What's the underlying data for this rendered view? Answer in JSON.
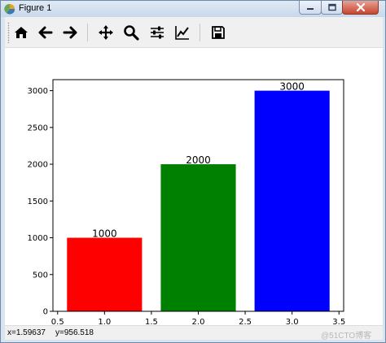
{
  "window": {
    "title": "Figure 1"
  },
  "toolbar": {
    "buttons": [
      {
        "icon": "home-icon"
      },
      {
        "icon": "back-arrow-icon"
      },
      {
        "icon": "forward-arrow-icon"
      },
      {
        "icon": "pan-icon"
      },
      {
        "icon": "zoom-icon"
      },
      {
        "icon": "subplots-icon"
      },
      {
        "icon": "edit-axis-icon"
      },
      {
        "icon": "save-icon"
      }
    ]
  },
  "status": {
    "x_readout": "x=1.59637",
    "y_readout": "y=956.518"
  },
  "watermark": "@51CTO博客",
  "chart_data": {
    "type": "bar",
    "x": [
      1.0,
      2.0,
      3.0
    ],
    "values": [
      1000,
      2000,
      3000
    ],
    "bar_width": 0.8,
    "colors": [
      "#ff0000",
      "#008000",
      "#0000ff"
    ],
    "data_labels": [
      "1000",
      "2000",
      "3000"
    ],
    "xlim": [
      0.45,
      3.55
    ],
    "ylim": [
      0,
      3150
    ],
    "x_ticks": [
      0.5,
      1.0,
      1.5,
      2.0,
      2.5,
      3.0,
      3.5
    ],
    "x_tick_labels": [
      "0.5",
      "1.0",
      "1.5",
      "2.0",
      "2.5",
      "3.0",
      "3.5"
    ],
    "y_ticks": [
      0,
      500,
      1000,
      1500,
      2000,
      2500,
      3000
    ],
    "y_tick_labels": [
      "0",
      "500",
      "1000",
      "1500",
      "2000",
      "2500",
      "3000"
    ],
    "grid": false
  }
}
